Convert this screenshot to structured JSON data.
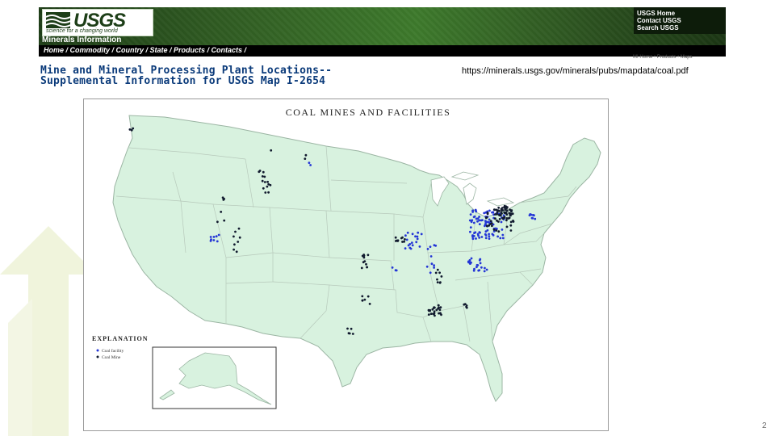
{
  "banner": {
    "logo_text": "USGS",
    "logo_tagline": "science for a changing world",
    "links": [
      "USGS Home",
      "Contact USGS",
      "Search USGS"
    ],
    "section_title": "Minerals Information",
    "nav": "Home / Commodity / Country / State / Products / Contacts /",
    "subnav": "MI Home • Products • Maps"
  },
  "page": {
    "title_line1": "Mine and Mineral Processing Plant Locations--",
    "title_line2": "Supplemental Information for USGS Map I-2654",
    "url": "https://minerals.usgs.gov/minerals/pubs/mapdata/coal.pdf",
    "page_number": "2"
  },
  "map": {
    "title": "COAL MINES AND FACILITIES",
    "explanation_title": "EXPLANATION",
    "legend": [
      {
        "label": "Coal facility",
        "color": "#2436d6"
      },
      {
        "label": "Coal Mine",
        "color": "#111a2e"
      }
    ],
    "land_color": "#d8f2df",
    "border_color": "#b7c9bb"
  },
  "colors": {
    "banner_dark": "#1e3d17",
    "title_blue": "#0a3a7a"
  }
}
